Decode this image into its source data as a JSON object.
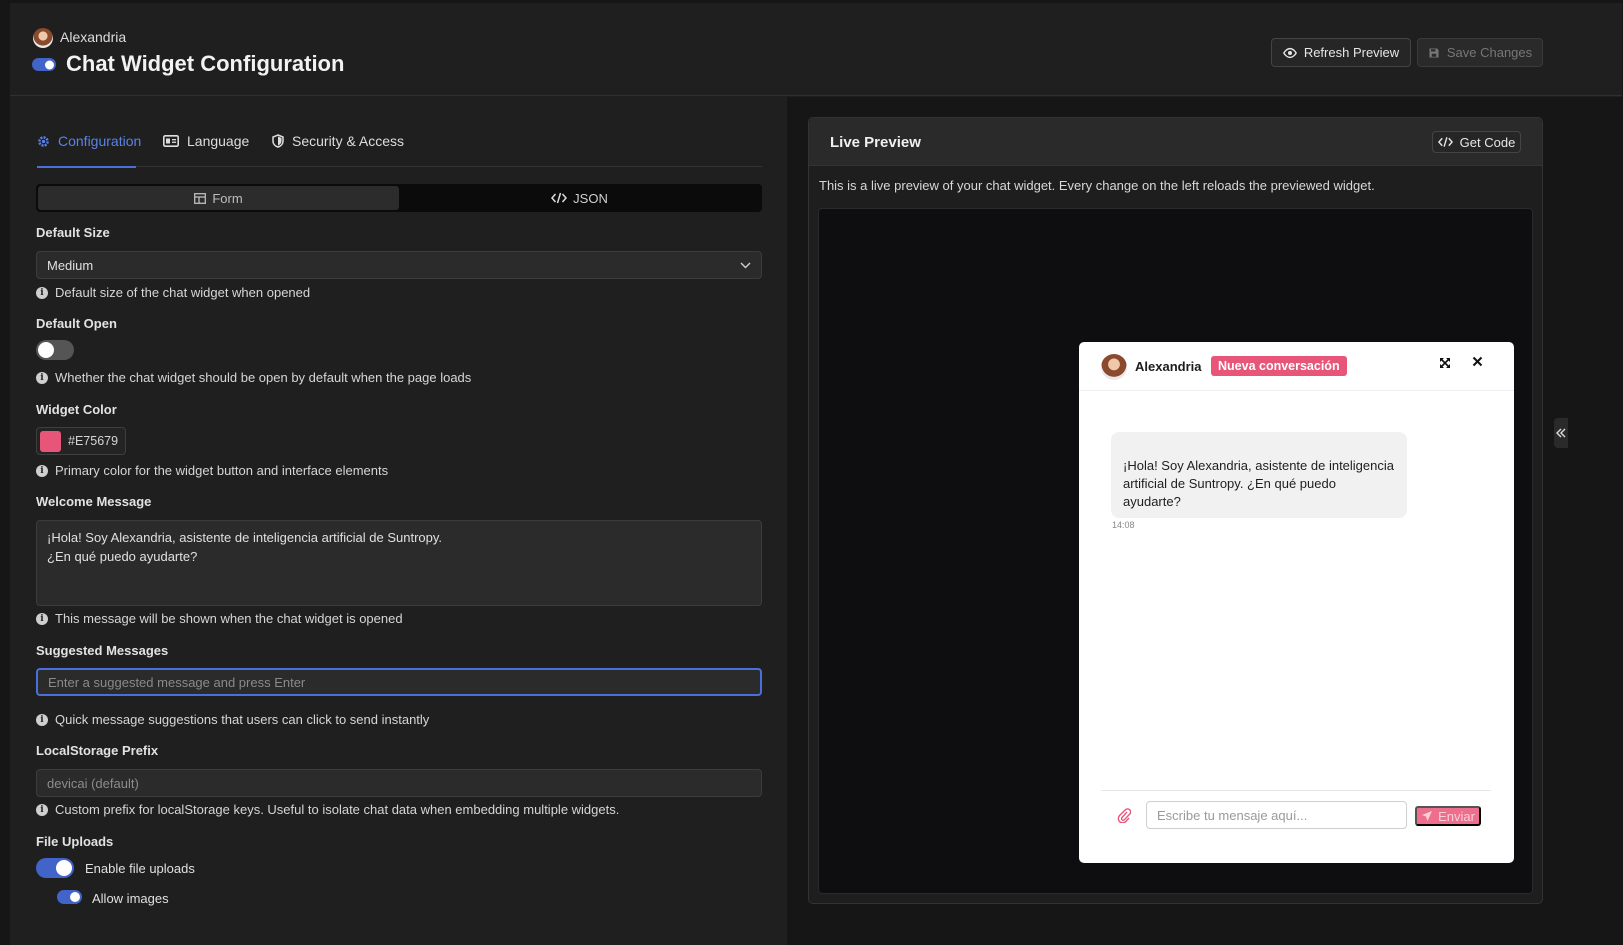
{
  "header": {
    "user_name": "Alexandria",
    "title": "Chat Widget Configuration",
    "refresh_label": "Refresh Preview",
    "save_label": "Save Changes",
    "enabled": true
  },
  "tabs": [
    {
      "label": "Configuration",
      "icon": "gear-icon",
      "active": true
    },
    {
      "label": "Language",
      "icon": "language-icon",
      "active": false
    },
    {
      "label": "Security & Access",
      "icon": "shield-icon",
      "active": false
    }
  ],
  "view_toggle": {
    "form_label": "Form",
    "json_label": "JSON",
    "selected": "Form"
  },
  "form": {
    "default_size": {
      "label": "Default Size",
      "value": "Medium",
      "help": "Default size of the chat widget when opened"
    },
    "default_open": {
      "label": "Default Open",
      "value": false,
      "help": "Whether the chat widget should be open by default when the page loads"
    },
    "widget_color": {
      "label": "Widget Color",
      "value": "#E75679",
      "help": "Primary color for the widget button and interface elements"
    },
    "welcome_message": {
      "label": "Welcome Message",
      "value": "¡Hola! Soy Alexandria, asistente de inteligencia artificial de Suntropy.\n¿En qué puedo ayudarte?",
      "help": "This message will be shown when the chat widget is opened"
    },
    "suggested_messages": {
      "label": "Suggested Messages",
      "placeholder": "Enter a suggested message and press Enter",
      "help": "Quick message suggestions that users can click to send instantly"
    },
    "localstorage_prefix": {
      "label": "LocalStorage Prefix",
      "placeholder": "devicai (default)",
      "help": "Custom prefix for localStorage keys. Useful to isolate chat data when embedding multiple widgets."
    },
    "file_uploads": {
      "label": "File Uploads",
      "enable_label": "Enable file uploads",
      "enabled": true,
      "images_label": "Allow images",
      "images_enabled": true
    }
  },
  "preview": {
    "title": "Live Preview",
    "code_label": "Get Code",
    "description": "This is a live preview of your chat widget. Every change on the left reloads the previewed widget.",
    "widget": {
      "name": "Alexandria",
      "badge": "Nueva conversación",
      "message": "¡Hola! Soy Alexandria, asistente de inteligencia artificial de Suntropy. ¿En qué puedo ayudarte?",
      "time": "14:08",
      "input_placeholder": "Escribe tu mensaje aquí...",
      "send_label": "Enviar"
    }
  },
  "colors": {
    "accent": "#4A6FD8",
    "widget": "#E75679"
  }
}
